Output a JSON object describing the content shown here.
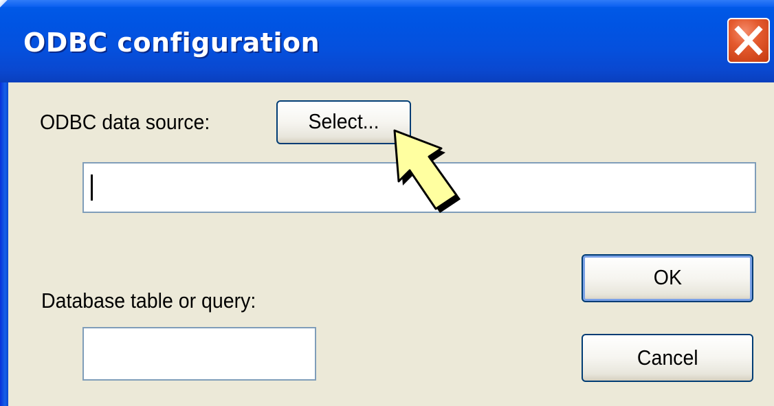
{
  "window": {
    "title": "ODBC configuration",
    "close_icon": "close-icon"
  },
  "form": {
    "odbc_label": "ODBC data source:",
    "select_button": "Select...",
    "odbc_value": "",
    "table_label": "Database table or query:",
    "table_value": ""
  },
  "actions": {
    "ok_label": "OK",
    "cancel_label": "Cancel"
  },
  "overlay": {
    "pointer_icon": "highlight-arrow-icon",
    "pointer_color": "#ffffa0"
  }
}
